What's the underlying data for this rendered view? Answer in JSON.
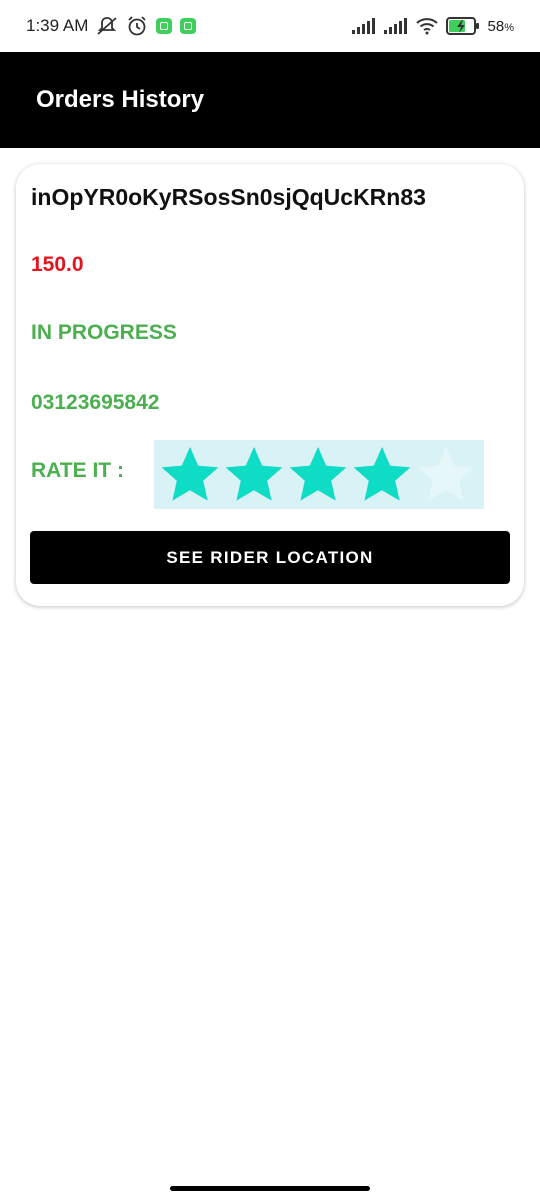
{
  "status_bar": {
    "time": "1:39 AM",
    "battery_percent": "58",
    "battery_unit": "%",
    "icons": [
      "notifications-muted-icon",
      "alarm-icon",
      "app-badge-icon",
      "app-badge-icon",
      "signal-icon",
      "signal-icon",
      "wifi-icon",
      "battery-charging-icon"
    ]
  },
  "app_bar": {
    "title": "Orders History"
  },
  "order": {
    "id": "inOpYR0oKyRSosSn0sjQqUcKRn83",
    "price": "150.0",
    "status": "IN PROGRESS",
    "phone": "03123695842",
    "rate_label": "RATE IT :",
    "rating": 4,
    "rating_max": 5,
    "button_label": "SEE RIDER LOCATION"
  },
  "colors": {
    "accent_star": "#0edcc4",
    "star_empty": "#e6f7f9",
    "price_red": "#e0151d",
    "status_green": "#4caf50",
    "app_bar_bg": "#000000"
  }
}
